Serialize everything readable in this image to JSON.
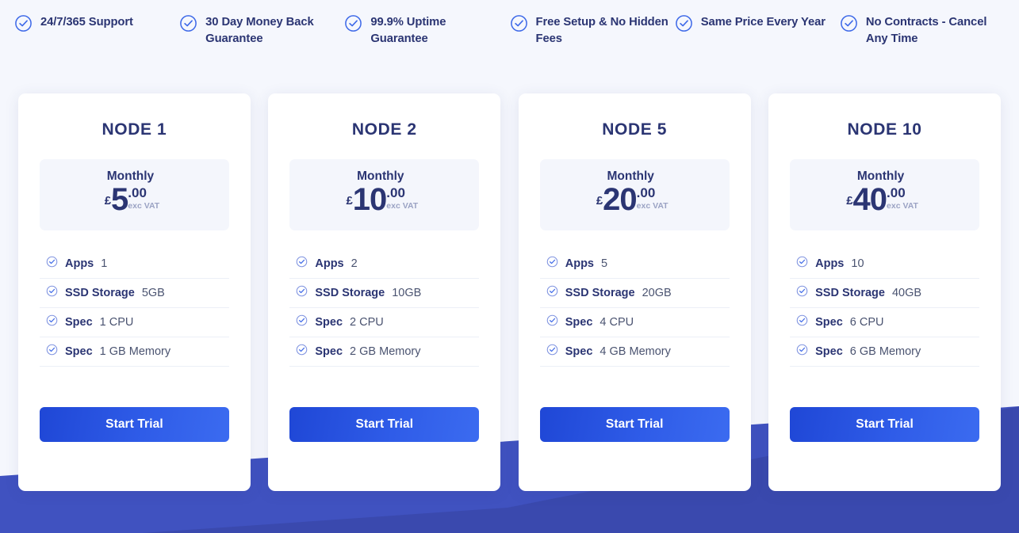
{
  "feature_bar": {
    "icon": "check-circle-icon",
    "items": [
      {
        "text": "24/7/365 Support"
      },
      {
        "text": "30 Day Money Back Guarantee"
      },
      {
        "text": "99.9% Uptime Guarantee"
      },
      {
        "text": "Free Setup & No Hidden Fees"
      },
      {
        "text": "Same Price Every Year"
      },
      {
        "text": "No Contracts - Cancel Any Time"
      }
    ]
  },
  "colors": {
    "page_background": "#f5f7fd",
    "brand_navy": "#2b3573",
    "accent_blue": "#2f5ce8",
    "check_icon": "#3f6ae8",
    "decor_blue_light": "#4052c0",
    "decor_blue_dark": "#3a49ae",
    "price_box_background": "#f4f6fc",
    "divider": "#eceff7"
  },
  "plans": [
    {
      "title": "NODE 1",
      "period": "Monthly",
      "currency": "£",
      "amount": "5",
      "cents": ".00",
      "vat_note": "exc VAT",
      "features": [
        {
          "label": "Apps",
          "value": "1"
        },
        {
          "label": "SSD Storage",
          "value": "5GB"
        },
        {
          "label": "Spec",
          "value": "1 CPU"
        },
        {
          "label": "Spec",
          "value": "1 GB Memory"
        }
      ],
      "cta_label": "Start Trial"
    },
    {
      "title": "NODE 2",
      "period": "Monthly",
      "currency": "£",
      "amount": "10",
      "cents": ".00",
      "vat_note": "exc VAT",
      "features": [
        {
          "label": "Apps",
          "value": "2"
        },
        {
          "label": "SSD Storage",
          "value": "10GB"
        },
        {
          "label": "Spec",
          "value": "2 CPU"
        },
        {
          "label": "Spec",
          "value": "2 GB Memory"
        }
      ],
      "cta_label": "Start Trial"
    },
    {
      "title": "NODE 5",
      "period": "Monthly",
      "currency": "£",
      "amount": "20",
      "cents": ".00",
      "vat_note": "exc VAT",
      "features": [
        {
          "label": "Apps",
          "value": "5"
        },
        {
          "label": "SSD Storage",
          "value": "20GB"
        },
        {
          "label": "Spec",
          "value": "4 CPU"
        },
        {
          "label": "Spec",
          "value": "4 GB Memory"
        }
      ],
      "cta_label": "Start Trial"
    },
    {
      "title": "NODE 10",
      "period": "Monthly",
      "currency": "£",
      "amount": "40",
      "cents": ".00",
      "vat_note": "exc VAT",
      "features": [
        {
          "label": "Apps",
          "value": "10"
        },
        {
          "label": "SSD Storage",
          "value": "40GB"
        },
        {
          "label": "Spec",
          "value": "6 CPU"
        },
        {
          "label": "Spec",
          "value": "6 GB Memory"
        }
      ],
      "cta_label": "Start Trial"
    }
  ]
}
